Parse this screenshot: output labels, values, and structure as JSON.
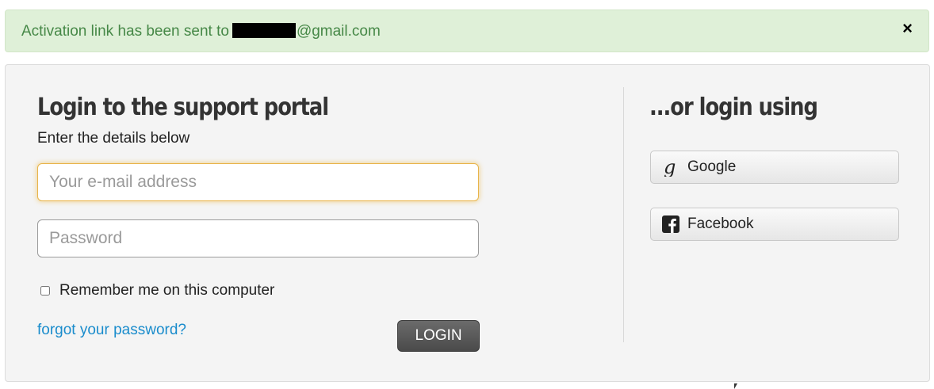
{
  "alert": {
    "prefix": "Activation link has been sent to",
    "email_suffix": "@gmail.com",
    "close_symbol": "×"
  },
  "login": {
    "title": "Login to the support portal",
    "subtitle": "Enter the details below",
    "email_placeholder": "Your e-mail address",
    "password_placeholder": "Password",
    "remember_label": "Remember me on this computer",
    "remember_checked": false,
    "forgot_label": "forgot your password?",
    "login_label": "LOGIN"
  },
  "alt_login": {
    "title": "...or login using",
    "providers": [
      {
        "label": "Google",
        "icon": "google-icon"
      },
      {
        "label": "Facebook",
        "icon": "facebook-icon"
      }
    ]
  },
  "colors": {
    "alert_bg": "#dff0d8",
    "alert_text": "#468847",
    "link": "#1a8ccc",
    "login_button": "#4a4a4a"
  }
}
